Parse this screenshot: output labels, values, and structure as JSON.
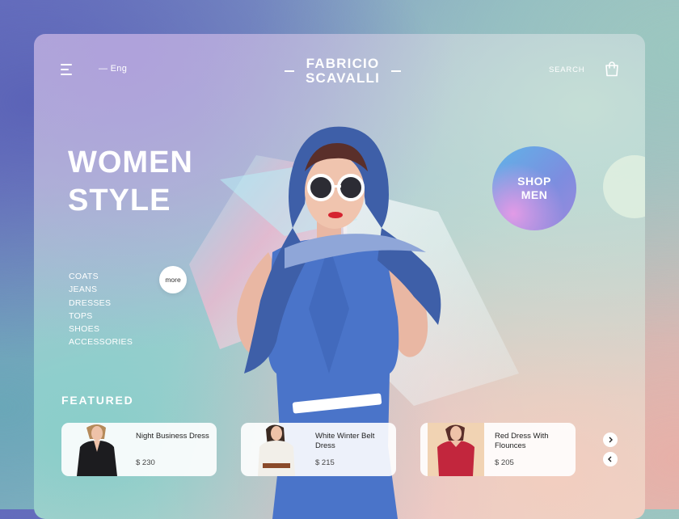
{
  "header": {
    "language": "— Eng",
    "brand_line1": "FABRICIO",
    "brand_line2": "SCAVALLI",
    "search_label": "SEARCH"
  },
  "hero": {
    "title_line1": "WOMEN",
    "title_line2": "STYLE",
    "categories": [
      "COATS",
      "JEANS",
      "DRESSES",
      "TOPS",
      "SHOES",
      "ACCESSORIES"
    ],
    "more_label": "more",
    "shop_men_line1": "SHOP",
    "shop_men_line2": "MEN"
  },
  "featured": {
    "title": "FEATURED",
    "products": [
      {
        "name": "Night Business Dress",
        "price": "$ 230",
        "dress_color": "#1c1c1f"
      },
      {
        "name": "White Winter Belt Dress",
        "price": "$ 215",
        "dress_color": "#f2efe9"
      },
      {
        "name": "Red Dress With Flounces",
        "price": "$ 205",
        "dress_color": "#c2263d"
      }
    ]
  },
  "colors": {
    "accent_blue": "#4a74c9",
    "text_white": "#ffffff"
  },
  "icons": {
    "menu": "menu-icon",
    "cart": "shopping-bag-icon",
    "next": "chevron-right-icon",
    "prev": "chevron-left-icon"
  }
}
